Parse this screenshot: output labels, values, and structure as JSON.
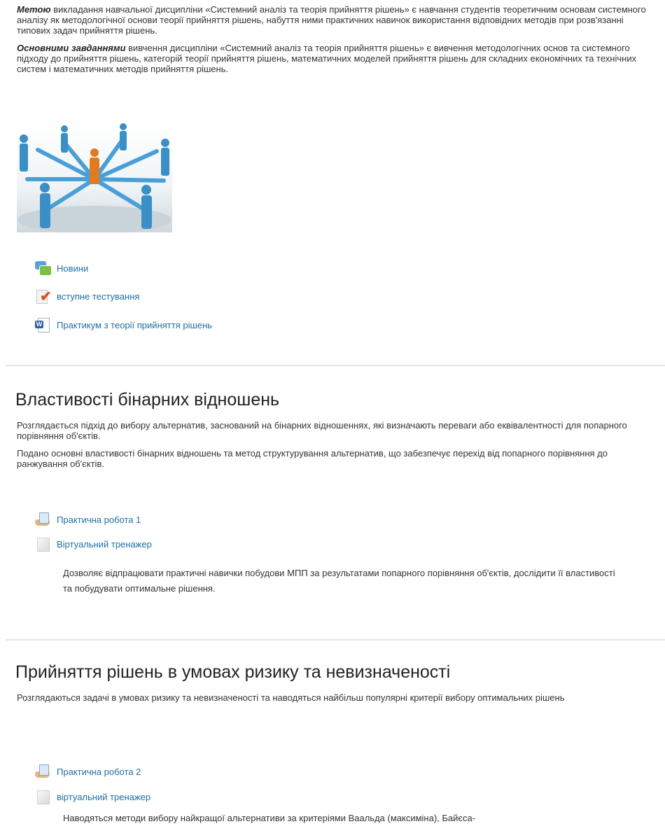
{
  "intro": {
    "goal_label": "Метою",
    "goal_text": " викладання навчальної дисципліни «Системний аналіз та теорія прийняття рішень» є  навчання студентів теоретичним основам системного аналізу як методологічної основи теорії прийняття рішень, набуття ними практичних навичок використання відповідних методів при розв'язанні типових задач прийняття рішень.",
    "tasks_label": "Основними завданнями",
    "tasks_text": " вивчення дисципліни «Системний аналіз та теорія прийняття рішень» є вивчення методологічних основ та системного підходу до прийняття рішень, категорій теорії прийняття рішень, математичних моделей прийняття рішень для складних економічних та технічних систем і математичних методів прийняття рішень."
  },
  "general_activities": [
    {
      "label": "Новини",
      "icon": "forum-icon"
    },
    {
      "label": "вступне тестування",
      "icon": "quiz-icon"
    },
    {
      "label": "Практикум з теорії прийняття рішень",
      "icon": "word-document-icon"
    }
  ],
  "section1": {
    "title": "Властивості бінарних відношень",
    "p1": "Розглядається підхід до вибору альтернатив, заснований на бінарних відношеннях, які визначають переваги або еквівалентності для попарного порівняння об'єктів.",
    "p2": "Подано основні властивості бінарних відношень та метод структурування альтернатив, що забезпечує перехід від попарного порівняння до ранжування об'єктів.",
    "activity1": "Практична робота 1",
    "activity2": "Віртуальний тренажер",
    "activity2_desc": "Дозволяє відпрацювати практичні навички побудови  МПП за результатами попарного порівняння об'єктів, дослідити її властивості та побудувати оптимальне рішення."
  },
  "section2": {
    "title": "Прийняття рішень в умовах ризику та невизначеності",
    "p1": "Розглядаються задачі в умовах ризику та невизначеності та наводяться найбільш популярні критерії вибору оптимальних рішень",
    "activity1": "Практична робота 2",
    "activity2": "віртуальний тренажер",
    "activity2_desc": "Наводяться методи вибору найкращої альтернативи за критеріями Ваальда (максиміна), Байєса-"
  },
  "colors": {
    "link": "#1d6fa5",
    "text": "#333333",
    "accent_person": "#e07b1f",
    "person": "#3a8fc6"
  }
}
